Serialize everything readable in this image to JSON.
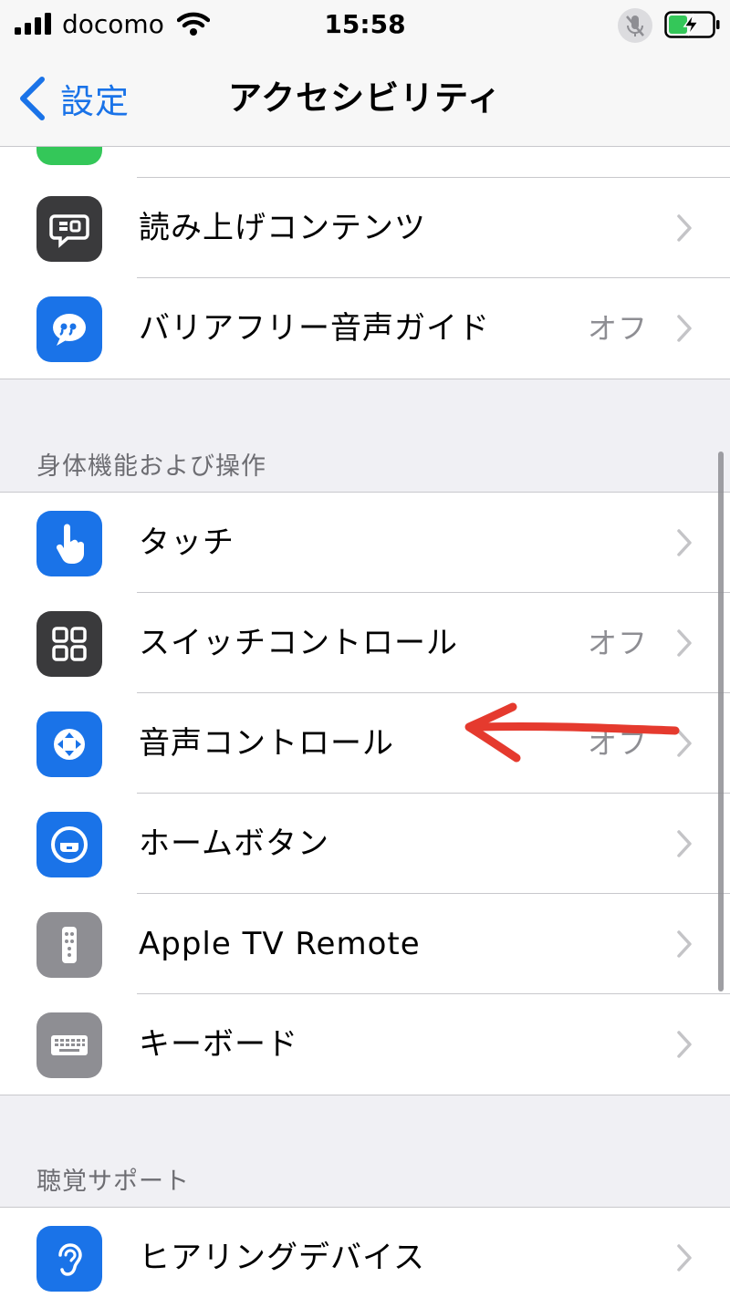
{
  "status_bar": {
    "carrier": "docomo",
    "time": "15:58"
  },
  "nav": {
    "back_label": "設定",
    "title": "アクセシビリティ"
  },
  "group_top": {
    "items": [
      {
        "label": "読み上げコンテンツ",
        "value": "",
        "icon": "speech-bubble-icon"
      },
      {
        "label": "バリアフリー音声ガイド",
        "value": "オフ",
        "icon": "quote-bubble-icon"
      }
    ]
  },
  "section_physical": {
    "header": "身体機能および操作",
    "items": [
      {
        "label": "タッチ",
        "value": "",
        "icon": "hand-icon"
      },
      {
        "label": "スイッチコントロール",
        "value": "オフ",
        "icon": "grid-icon"
      },
      {
        "label": "音声コントロール",
        "value": "オフ",
        "icon": "voice-control-icon"
      },
      {
        "label": "ホームボタン",
        "value": "",
        "icon": "home-button-icon"
      },
      {
        "label": "Apple TV Remote",
        "value": "",
        "icon": "remote-icon"
      },
      {
        "label": "キーボード",
        "value": "",
        "icon": "keyboard-icon"
      }
    ]
  },
  "section_hearing": {
    "header": "聴覚サポート",
    "items": [
      {
        "label": "ヒアリングデバイス",
        "value": "",
        "icon": "ear-icon"
      }
    ]
  },
  "colors": {
    "accent": "#1a73e8",
    "annotation": "#e53a2e"
  }
}
